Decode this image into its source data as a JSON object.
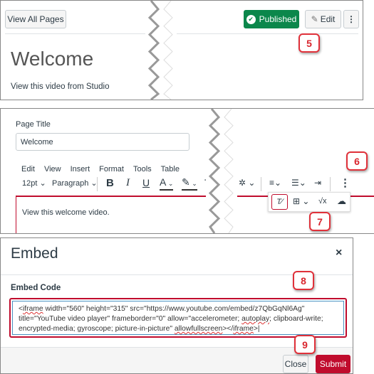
{
  "page_view": {
    "view_all_pages": "View All Pages",
    "published": "Published",
    "edit": "Edit",
    "title": "Welcome",
    "body": "View this video from Studio",
    "callout": "5"
  },
  "editor": {
    "page_title_label": "Page Title",
    "page_title_value": "Welcome",
    "menu": [
      "Edit",
      "View",
      "Insert",
      "Format",
      "Tools",
      "Table"
    ],
    "font_size": "12pt",
    "block": "Paragraph",
    "content": "View this welcome video.",
    "callout_more": "6",
    "callout_embed": "7"
  },
  "embed_dialog": {
    "title": "Embed",
    "close_x": "×",
    "label": "Embed Code",
    "code_parts": [
      "<",
      "iframe",
      " width=\"560\" height=\"315\" src=\"https://www.youtube.com/embed/z7QbGqNl6Ag\" title=\"YouTube video player\" frameborder=\"0\" allow=\"accelerometer; ",
      "autoplay",
      "; clipboard-write; encrypted-media; gyroscope; picture-in-picture\" ",
      "allowfullscreen",
      "></",
      "iframe",
      ">"
    ],
    "close": "Close",
    "submit": "Submit",
    "callout_code": "8",
    "callout_submit": "9"
  },
  "colors": {
    "published": "#0b874b",
    "accent_red": "#c00c2d",
    "callout": "#e0313a"
  }
}
